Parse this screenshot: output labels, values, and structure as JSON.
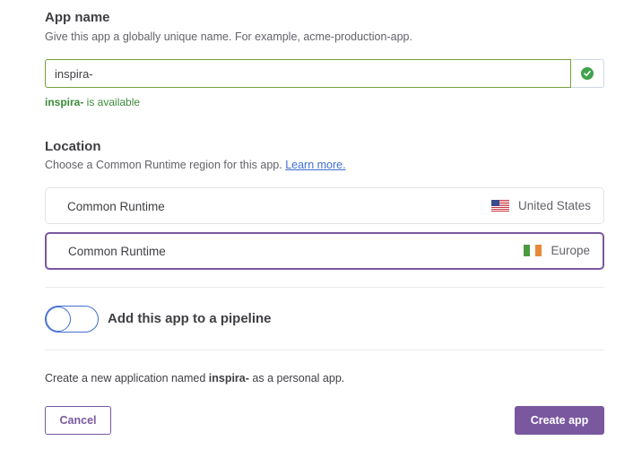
{
  "app_name": {
    "title": "App name",
    "help": "Give this app a globally unique name. For example, acme-production-app.",
    "value": "inspira-",
    "check_icon": "check-circle-icon",
    "availability_name": "inspira-",
    "availability_text": " is available"
  },
  "location": {
    "title": "Location",
    "help": "Choose a Common Runtime region for this app. ",
    "learn_more": "Learn more.",
    "regions": [
      {
        "name": "Common Runtime",
        "region": "United States",
        "flag": "us-flag-icon",
        "selected": false
      },
      {
        "name": "Common Runtime",
        "region": "Europe",
        "flag": "ireland-flag-icon",
        "selected": true
      }
    ]
  },
  "pipeline": {
    "label": "Add this app to a pipeline",
    "enabled": false
  },
  "summary": {
    "prefix": "Create a new application named ",
    "app_name": "inspira-",
    "suffix": " as a personal app."
  },
  "actions": {
    "cancel": "Cancel",
    "create": "Create app"
  },
  "colors": {
    "accent": "#79589f",
    "success": "#3fa34d",
    "link": "#3f6ecf"
  }
}
